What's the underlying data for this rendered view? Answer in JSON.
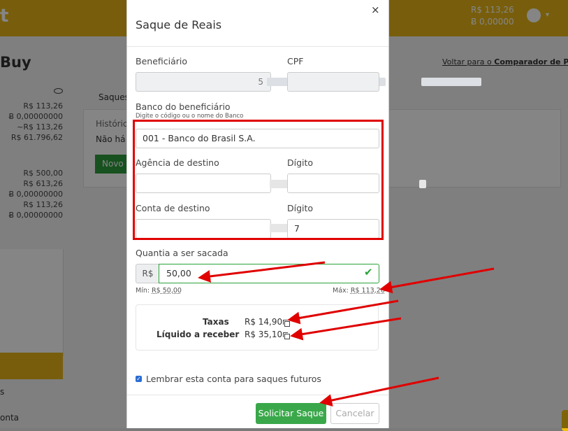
{
  "background": {
    "logo_char": "t",
    "balance_brl": "R$ 113,26",
    "balance_btc": "Ƀ 0,00000",
    "page_title": "Buy",
    "compare_link_prefix": "Voltar para o",
    "compare_link_strong": "Comparador de Preços",
    "tab_label": "Saques",
    "history_label": "Históric",
    "no_items": "Não há",
    "new_button": "Novo s",
    "left_values": [
      "R$ 113,26",
      "Ƀ 0,00000000",
      "~R$ 113,26",
      "R$ 61.796,62",
      "R$ 500,00",
      "R$ 613,26",
      "Ƀ 0,00000000",
      "R$ 113,26",
      "Ƀ 0,00000000"
    ],
    "side_items": [
      "s",
      "onta"
    ]
  },
  "modal": {
    "title": "Saque de Reais",
    "close_symbol": "×",
    "beneficiary_label": "Beneficiário",
    "beneficiary_value_tail": "5",
    "cpf_label": "CPF",
    "bank_label": "Banco do beneficiário",
    "bank_hint": "Digite o código ou o nome do Banco",
    "bank_value": "001 - Banco do Brasil S.A.",
    "agency_label": "Agência de destino",
    "agency_digit_label": "Dígito",
    "account_label": "Conta de destino",
    "account_digit_label": "Dígito",
    "account_digit_value": "7",
    "amount_label": "Quantia a ser sacada",
    "currency_addon": "R$",
    "amount_value": "50,00",
    "min_prefix": "Mín:",
    "min_value": "R$ 50,00",
    "max_prefix": "Máx:",
    "max_value": "R$ 113,26",
    "fee_label": "Taxas",
    "fee_value": "R$ 14,90",
    "net_label": "Líquido a receber",
    "net_value": "R$ 35,10",
    "remember_label": "Lembrar esta conta para saques futuros",
    "remember_checked": true,
    "submit_label": "Solicitar Saque",
    "cancel_label": "Cancelar"
  },
  "colors": {
    "brand": "#e7b417",
    "success": "#3aa84a",
    "annotation": "#e00000"
  }
}
